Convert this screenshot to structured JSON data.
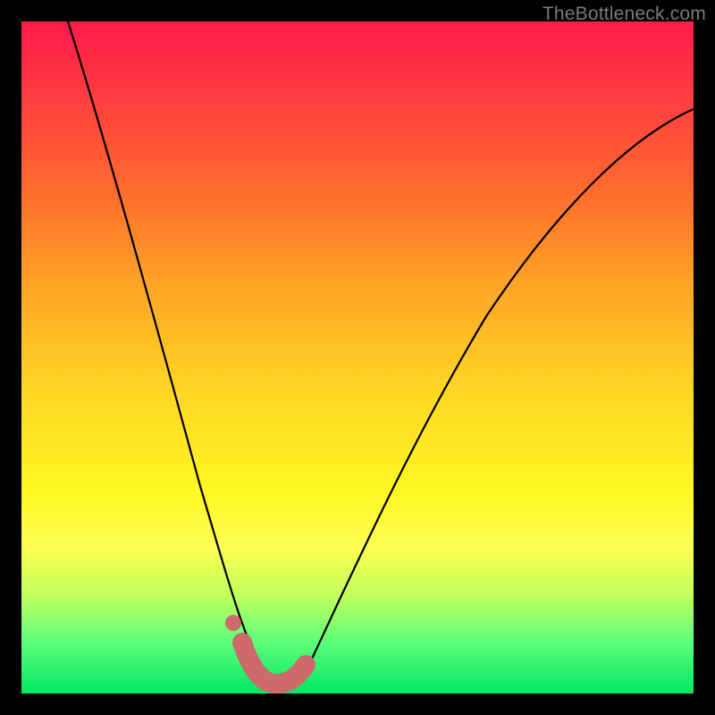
{
  "watermark": "TheBottleneck.com",
  "chart_data": {
    "type": "line",
    "title": "",
    "xlabel": "",
    "ylabel": "",
    "xlim": [
      0,
      100
    ],
    "ylim": [
      0,
      100
    ],
    "series": [
      {
        "name": "bottleneck-curve",
        "x": [
          7,
          10,
          14,
          18,
          22,
          25,
          28,
          30,
          32,
          34,
          36,
          38,
          40,
          44,
          48,
          55,
          62,
          70,
          78,
          86,
          94,
          100
        ],
        "values": [
          100,
          85,
          68,
          52,
          38,
          27,
          18,
          12,
          7,
          3,
          1,
          0,
          0.5,
          4,
          11,
          25,
          38,
          52,
          63,
          73,
          81,
          87
        ]
      }
    ],
    "accent_segment": {
      "name": "highlight-near-minimum",
      "x": [
        32.5,
        34,
        36,
        38,
        40,
        41.5
      ],
      "values": [
        6,
        2.5,
        0.8,
        0.6,
        1.8,
        4.5
      ]
    },
    "accent_dot": {
      "x": 31.3,
      "y": 8.5
    },
    "colors": {
      "curve": "#000000",
      "accent": "#cd6a6b",
      "gradient_top": "#ff1a4b",
      "gradient_bottom": "#00e865"
    }
  }
}
